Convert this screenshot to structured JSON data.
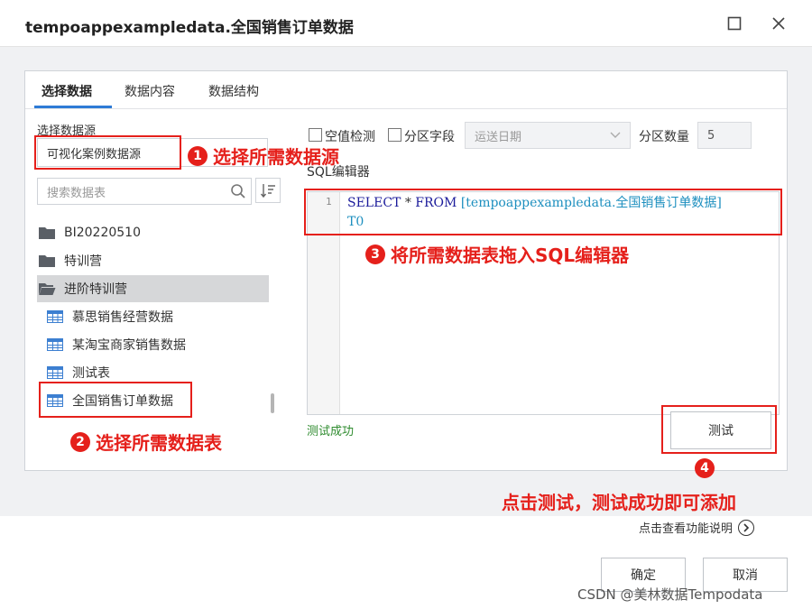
{
  "window": {
    "title": "tempoappexampledata.全国销售订单数据",
    "maximize_glyph": "☐",
    "close_glyph": "✕"
  },
  "tabs": [
    {
      "label": "选择数据",
      "active": true
    },
    {
      "label": "数据内容",
      "active": false
    },
    {
      "label": "数据结构",
      "active": false
    }
  ],
  "datasource": {
    "label": "选择数据源",
    "value": "可视化案例数据源"
  },
  "search": {
    "placeholder": "搜索数据表",
    "icon": "search-icon",
    "sort_icon": "sort-icon"
  },
  "tree": {
    "folders": [
      {
        "label": "BI20220510",
        "icon": "folder-icon"
      },
      {
        "label": "特训营",
        "icon": "folder-icon"
      },
      {
        "label": "进阶特训营",
        "icon": "folder-open-icon",
        "selected": true
      }
    ],
    "tables": [
      {
        "label": "慕思销售经营数据",
        "icon": "table-icon"
      },
      {
        "label": "某淘宝商家销售数据",
        "icon": "table-icon"
      },
      {
        "label": "测试表",
        "icon": "table-icon"
      },
      {
        "label": "全国销售订单数据",
        "icon": "table-icon"
      }
    ]
  },
  "options": {
    "null_check_label": "空值检测",
    "partition_field_label": "分区字段",
    "partition_field_value": "运送日期",
    "partition_count_label": "分区数量",
    "partition_count_value": "5"
  },
  "editor": {
    "label": "SQL编辑器",
    "line_number": "1",
    "kw_select": "SELECT",
    "star": " * ",
    "kw_from": "FROM",
    "table_ref": " [tempoappexampledata.全国销售订单数据]",
    "alias": "T0"
  },
  "status": {
    "success_text": "测试成功"
  },
  "buttons": {
    "test": "测试",
    "confirm": "确定",
    "cancel": "取消"
  },
  "help": {
    "text": "点击查看功能说明",
    "icon": "chevron-right-circle-icon"
  },
  "annotations": {
    "step1_num": "1",
    "step1": "选择所需数据源",
    "step2_num": "2",
    "step2": "选择所需数据表",
    "step3_num": "3",
    "step3": "将所需数据表拖入SQL编辑器",
    "step4_num": "4",
    "step4": "点击测试，测试成功即可添加"
  },
  "watermark": "CSDN @美林数据Tempodata",
  "colors": {
    "annotation_red": "#e5201b",
    "tab_accent": "#2e7bd6",
    "success_green": "#2e8b2e",
    "sql_keyword": "#1b1b9b",
    "sql_table": "#1d8fbf"
  }
}
